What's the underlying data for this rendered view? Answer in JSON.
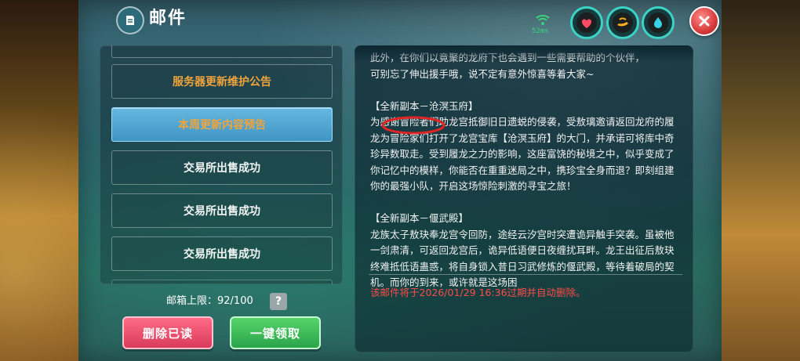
{
  "window": {
    "title": "邮件",
    "ping": "52ms"
  },
  "mail_list": {
    "items": [
      {
        "label": "服务器更新维护公告",
        "style": "orange"
      },
      {
        "label": "本周更新内容预告",
        "style": "active"
      },
      {
        "label": "交易所出售成功",
        "style": "white"
      },
      {
        "label": "交易所出售成功",
        "style": "white"
      },
      {
        "label": "交易所出售成功",
        "style": "white"
      }
    ],
    "limit_text": "邮箱上限：92/100",
    "help_label": "?"
  },
  "buttons": {
    "delete_read": "删除已读",
    "claim_all": "一键领取"
  },
  "content": {
    "lines_top": [
      "此外，在你们以竟聚的龙府下也会遇到一些需要帮助的个伙伴，",
      "可别忘了伸出援手哦，说不定有意外惊喜等着大家~"
    ],
    "section1_title": "【全新副本－沧溟玉府】",
    "section1_body": "为感谢冒险者们助龙宫抵御旧日遗蜕的侵袭，受敖璃邀请返回龙府的履龙为冒险家们打开了龙宫宝库【沧溟玉府】的大门，并承诺可将库中奇珍异数取走。受到履龙之力的影响，这座富饶的秘境之中，似乎变成了你记忆中的模样，你能否在重重迷局之中，携珍宝全身而退？即刻组建你的最强小队，开启这场惊险刺激的寻宝之旅！",
    "section2_title": "【全新副本－偃武殿】",
    "section2_body": "龙族太子敖玦奉龙宫令回防，途经云汐宫时突遭诡异触手突袭。虽被他一剑肃清，可返回龙宫后，诡异低语便日夜缠扰耳畔。龙王出征后敖玦终难抵低语蛊惑，将自身锁入昔日习武修炼的偃武殿，等待着破局的契机。而你的到来，或许就是这场困",
    "expire_notice": "该邮件将于2026/01/29 16:36过期并自动删除。"
  },
  "colors": {
    "orange": "#f0a43c",
    "red_notice": "#ff4b4b",
    "active_blue": "#4ea6d4",
    "delete_pink": "#e84a6a",
    "claim_green": "#3cbc58"
  },
  "icons": {
    "title": "mail-icon",
    "hud": [
      "wifi-icon",
      "heart-icon",
      "stamina-icon",
      "water-drop-icon"
    ],
    "close": "close-icon"
  }
}
